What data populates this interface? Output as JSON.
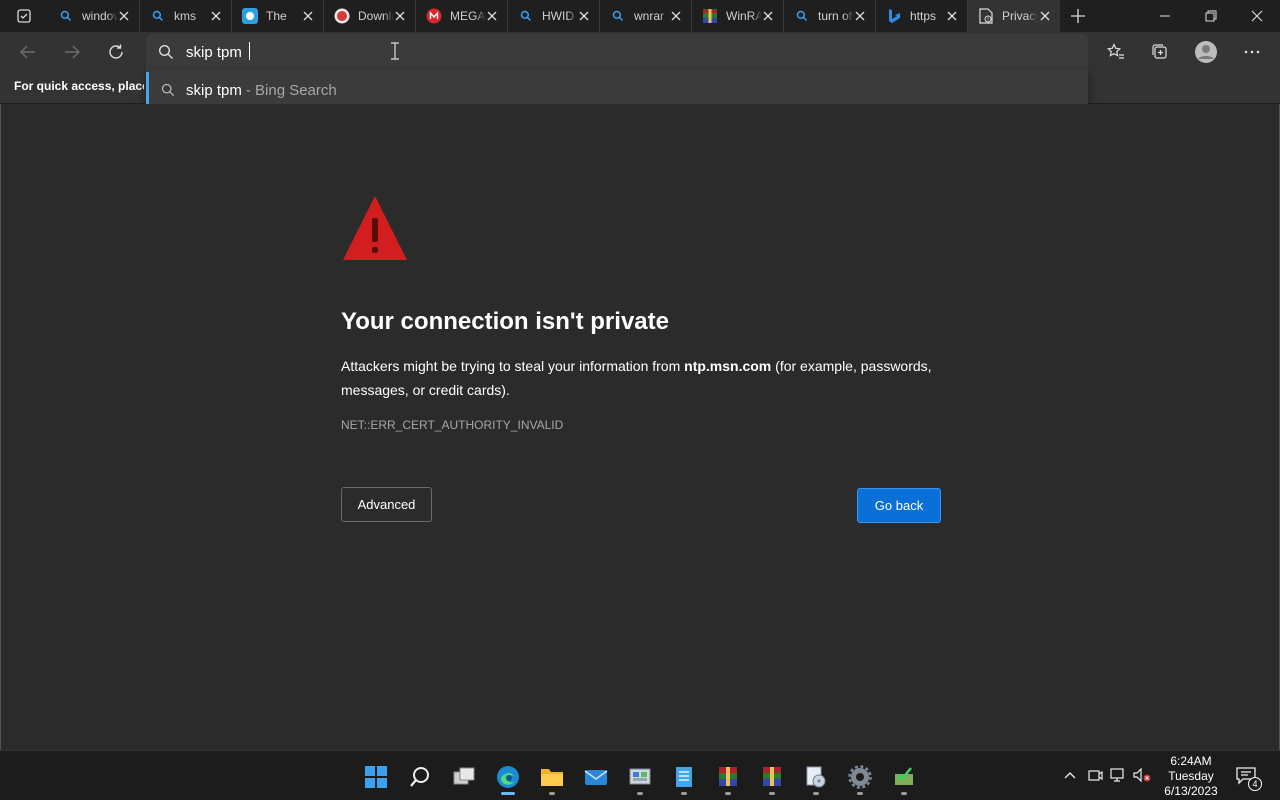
{
  "browser": {
    "tabs": [
      {
        "title": "windows",
        "icon": "search-icon"
      },
      {
        "title": "kms",
        "icon": "search-icon"
      },
      {
        "title": "The ",
        "icon": "site-icon"
      },
      {
        "title": "Download",
        "icon": "download-site-icon"
      },
      {
        "title": "MEGA",
        "icon": "mega-icon"
      },
      {
        "title": "HWID",
        "icon": "search-icon"
      },
      {
        "title": "wnrar",
        "icon": "search-icon"
      },
      {
        "title": "WinRAR",
        "icon": "winrar-icon"
      },
      {
        "title": "turn off",
        "icon": "search-icon"
      },
      {
        "title": "https",
        "icon": "bing-icon"
      },
      {
        "title": "Privacy error",
        "icon": "page-icon",
        "active": true
      }
    ],
    "address_value": "skip tpm",
    "favorites_hint": "For quick access, place your favorites here"
  },
  "suggestion": {
    "query": "skip tpm",
    "source": "- Bing Search"
  },
  "error_page": {
    "title": "Your connection isn't private",
    "desc_before": "Attackers might be trying to steal your information from ",
    "host": "ntp.msn.com",
    "desc_after": " (for example, passwords, messages, or credit cards).",
    "code": "NET::ERR_CERT_AUTHORITY_INVALID",
    "advanced_label": "Advanced",
    "go_back_label": "Go back"
  },
  "taskbar": {
    "time": "6:24AM",
    "day": "Tuesday",
    "date": "6/13/2023",
    "notification_count": "4"
  },
  "colors": {
    "accent": "#0a6fd6",
    "warning": "#d21e1e"
  }
}
